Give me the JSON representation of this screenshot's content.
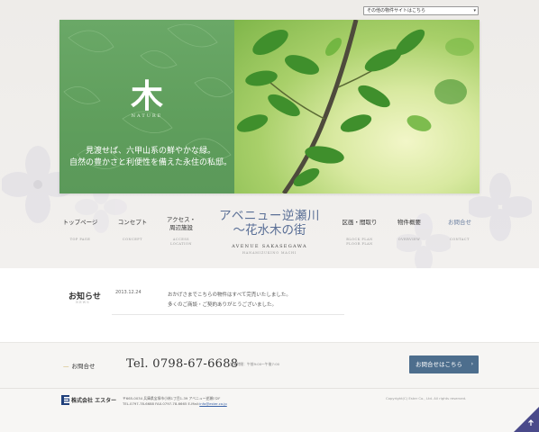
{
  "site_selector": {
    "selected": "その他の物件サイトはこちら",
    "arrow": "▾"
  },
  "hero": {
    "kanji": "木",
    "nature": "NATURE",
    "copy_line1": "見渡せば、六甲山系の鮮やかな緑。",
    "copy_line2": "自然の豊かさと利便性を備えた永住の私邸。",
    "panel_color": "#63a360"
  },
  "nav": {
    "left": [
      {
        "label": "トップページ",
        "en": "TOP PAGE"
      },
      {
        "label": "コンセプト",
        "en": "CONCEPT"
      },
      {
        "label_line1": "アクセス・",
        "label_line2": "周辺施設",
        "en_line1": "ACCESS",
        "en_line2": "LOCATION"
      }
    ],
    "right": [
      {
        "label": "区画・間取り",
        "en_line1": "BLOCK PLAN",
        "en_line2": "FLOOR PLAN"
      },
      {
        "label": "物件概要",
        "en": "OVERVIEW"
      },
      {
        "label": "お問合せ",
        "en": "CONTACT"
      }
    ]
  },
  "brand": {
    "name": "アベニュー逆瀬川",
    "tagline": "〜花水木の街",
    "en_name": "AVENUE SAKASEGAWA",
    "en_sub": "HANAMIZUKINO MACHI",
    "color": "#5a6f96"
  },
  "news": {
    "title": "お知らせ",
    "title_en": "NEWS",
    "date": "2013.12.24",
    "line1": "おかげさまでこちらの物件はすべて完売いたしました。",
    "line2": "多くのご商談・ご契約ありがとうございました。"
  },
  "contact": {
    "dash": "—",
    "label": "お問合せ",
    "phone": "Tel. 0798-67-6688",
    "hours": "営業時間：午前9:00〜午後7:00",
    "button": "お問合せはこちら",
    "button_chevron": "›",
    "button_color": "#4d6e8d"
  },
  "footer": {
    "company": "株式会社 エスター",
    "address_line1": "〒665-0034 兵庫県宝塚市小林1丁目1-39 アベニュー逆瀬川2F",
    "address_line2_prefix": "TEL.0797-78-6688 FAX.0797-78-6665 E-Mail:",
    "email": "info@ester.co.jp",
    "copyright": "Copyright(C) Ester Co., Ltd. All rights reserved.",
    "pagetop_icon": "arrow-up-icon"
  }
}
